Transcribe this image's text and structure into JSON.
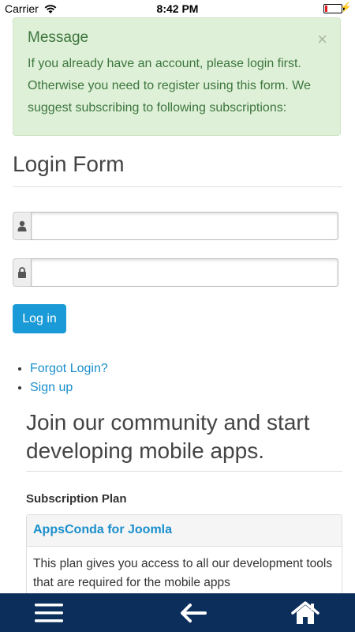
{
  "status_bar": {
    "carrier": "Carrier",
    "time": "8:42 PM"
  },
  "alert": {
    "title": "Message",
    "close": "×",
    "text": "If you already have an account, please login first. Otherwise you need to register using this form. We suggest subscribing to following subscriptions:"
  },
  "login": {
    "title": "Login Form",
    "username_value": "",
    "password_value": "",
    "button": "Log in"
  },
  "links": [
    "Forgot Login?",
    "Sign up"
  ],
  "join": {
    "title": "Join our community and start developing mobile apps."
  },
  "subscription": {
    "label": "Subscription Plan",
    "plan_name": "AppsConda for Joomla",
    "plan_description": "This plan gives you access to all our development tools that are required for the mobile apps"
  },
  "colors": {
    "alert_bg": "#dff0d8",
    "alert_text": "#3c763d",
    "primary": "#1a9ad6",
    "link": "#1a8fcc",
    "bottom_nav": "#0b2e5a"
  },
  "icons": {
    "wifi": "wifi-icon",
    "battery": "battery-icon",
    "user": "user-icon",
    "lock": "lock-icon",
    "menu": "menu-icon",
    "back": "arrow-left-icon",
    "home": "home-icon"
  }
}
